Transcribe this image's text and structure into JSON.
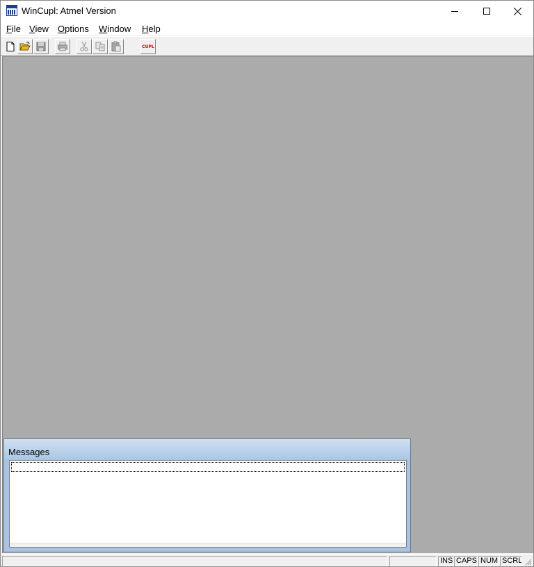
{
  "window": {
    "title": "WinCupl:  Atmel Version",
    "app_icon": "wincupl-app-icon"
  },
  "menu": {
    "items": [
      {
        "label": "File"
      },
      {
        "label": "View"
      },
      {
        "label": "Options"
      },
      {
        "label": "Window"
      },
      {
        "label": "Help"
      }
    ]
  },
  "toolbar": {
    "buttons": [
      {
        "icon": "new-file-icon",
        "enabled": true
      },
      {
        "icon": "open-folder-icon",
        "enabled": true
      },
      {
        "icon": "save-icon",
        "enabled": false
      },
      {
        "icon": "print-icon",
        "enabled": false
      },
      {
        "icon": "cut-icon",
        "enabled": false
      },
      {
        "icon": "copy-icon",
        "enabled": false
      },
      {
        "icon": "paste-icon",
        "enabled": false
      },
      {
        "icon": "cupl-compile-icon",
        "enabled": true,
        "label": "CUPL"
      }
    ]
  },
  "messages": {
    "title": "Messages"
  },
  "statusbar": {
    "ins": "INS",
    "caps": "CAPS",
    "num": "NUM",
    "scrl": "SCRL"
  },
  "colors": {
    "mdi_background": "#ababab",
    "messages_title_gradient_top": "#cfe0f1",
    "messages_title_gradient_bottom": "#a9c6e4",
    "cupl_label": "#d40000"
  }
}
